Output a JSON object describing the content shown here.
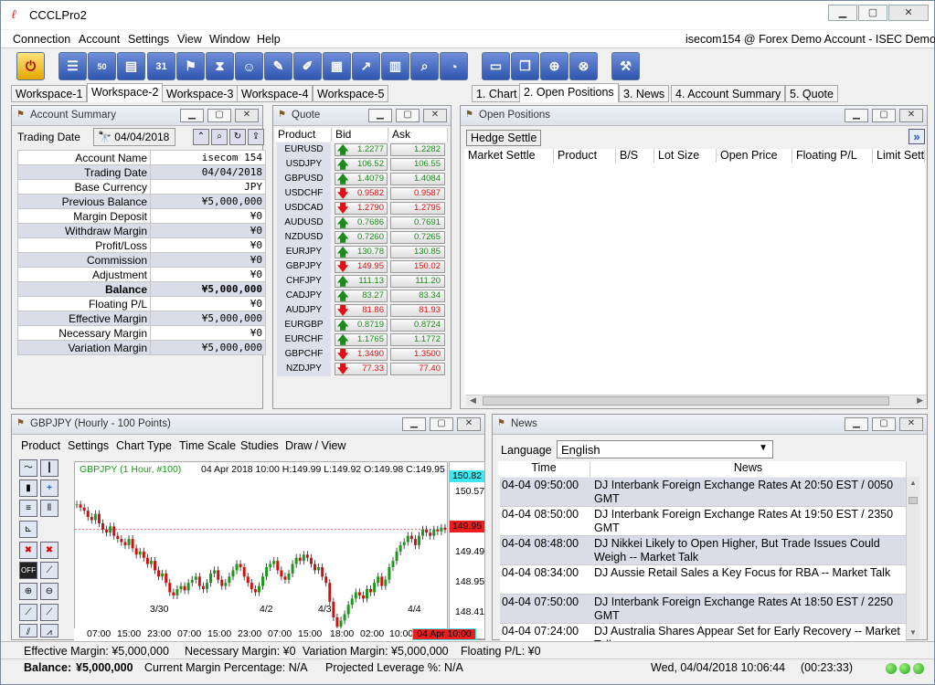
{
  "app": {
    "title": "CCCLPro2"
  },
  "menu": [
    "Connection",
    "Account",
    "Settings",
    "View",
    "Window",
    "Help"
  ],
  "account_label": "isecom154 @ Forex Demo Account - ISEC Demo",
  "workspace_tabs": [
    "Workspace-1",
    "Workspace-2",
    "Workspace-3",
    "Workspace-4",
    "Workspace-5"
  ],
  "view_tabs": [
    "1. Chart",
    "2. Open Positions",
    "3. News",
    "4. Account Summary",
    "5. Quote"
  ],
  "account_summary": {
    "title": "Account Summary",
    "trading_date_label": "Trading Date",
    "trading_date": "04/04/2018",
    "rows": [
      {
        "k": "Account Name",
        "v": "isecom 154"
      },
      {
        "k": "Trading Date",
        "v": "04/04/2018"
      },
      {
        "k": "Base Currency",
        "v": "JPY"
      },
      {
        "k": "Previous Balance",
        "v": "¥5,000,000"
      },
      {
        "k": "Margin Deposit",
        "v": "¥0"
      },
      {
        "k": "Withdraw Margin",
        "v": "¥0"
      },
      {
        "k": "Profit/Loss",
        "v": "¥0"
      },
      {
        "k": "Commission",
        "v": "¥0"
      },
      {
        "k": "Adjustment",
        "v": "¥0"
      },
      {
        "k": "Balance",
        "v": "¥5,000,000"
      },
      {
        "k": "Floating P/L",
        "v": "¥0"
      },
      {
        "k": "Effective Margin",
        "v": "¥5,000,000"
      },
      {
        "k": "Necessary Margin",
        "v": "¥0"
      },
      {
        "k": "Variation Margin",
        "v": "¥5,000,000"
      }
    ]
  },
  "quote": {
    "title": "Quote",
    "headers": [
      "Product",
      "Bid",
      "Ask"
    ],
    "rows": [
      {
        "p": "EURUSD",
        "bid": "1.2277",
        "ask": "1.2282",
        "dir": "up"
      },
      {
        "p": "USDJPY",
        "bid": "106.52",
        "ask": "106.55",
        "dir": "up"
      },
      {
        "p": "GBPUSD",
        "bid": "1.4079",
        "ask": "1.4084",
        "dir": "up"
      },
      {
        "p": "USDCHF",
        "bid": "0.9582",
        "ask": "0.9587",
        "dir": "down"
      },
      {
        "p": "USDCAD",
        "bid": "1.2790",
        "ask": "1.2795",
        "dir": "down"
      },
      {
        "p": "AUDUSD",
        "bid": "0.7686",
        "ask": "0.7691",
        "dir": "up"
      },
      {
        "p": "NZDUSD",
        "bid": "0.7260",
        "ask": "0.7265",
        "dir": "up"
      },
      {
        "p": "EURJPY",
        "bid": "130.78",
        "ask": "130.85",
        "dir": "up"
      },
      {
        "p": "GBPJPY",
        "bid": "149.95",
        "ask": "150.02",
        "dir": "down"
      },
      {
        "p": "CHFJPY",
        "bid": "111.13",
        "ask": "111.20",
        "dir": "up"
      },
      {
        "p": "CADJPY",
        "bid": "83.27",
        "ask": "83.34",
        "dir": "up"
      },
      {
        "p": "AUDJPY",
        "bid": "81.86",
        "ask": "81.93",
        "dir": "down"
      },
      {
        "p": "EURGBP",
        "bid": "0.8719",
        "ask": "0.8724",
        "dir": "up"
      },
      {
        "p": "EURCHF",
        "bid": "1.1765",
        "ask": "1.1772",
        "dir": "up"
      },
      {
        "p": "GBPCHF",
        "bid": "1.3490",
        "ask": "1.3500",
        "dir": "down"
      },
      {
        "p": "NZDJPY",
        "bid": "77.33",
        "ask": "77.40",
        "dir": "down"
      }
    ]
  },
  "open_positions": {
    "title": "Open Positions",
    "hedge_button": "Hedge Settle",
    "columns": [
      "Market Settle",
      "Product",
      "B/S",
      "Lot Size",
      "Open Price",
      "Floating P/L",
      "Limit Settle"
    ]
  },
  "chart": {
    "title": "GBPJPY (Hourly - 100 Points)",
    "menu": [
      "Product",
      "Settings",
      "Chart Type",
      "Time Scale",
      "Studies",
      "Draw / View"
    ],
    "legend": "GBPJPY (1 Hour, #100)",
    "ohlc": "04 Apr 2018 10:00 H:149.99 L:149.92 O:149.98 C:149.95",
    "y_ticks": [
      "150.57",
      "149.49",
      "148.95",
      "148.41"
    ],
    "y_top_tag": "150.82",
    "y_current_tag": "149.95",
    "x_ticks": [
      "07:00",
      "15:00",
      "23:00",
      "07:00",
      "15:00",
      "23:00",
      "07:00",
      "15:00",
      "18:00",
      "02:00",
      "10:00",
      "18:00"
    ],
    "x_current_tag": "04 Apr 10:00",
    "date_labels": [
      "3/30",
      "4/2",
      "4/3",
      "4/4"
    ]
  },
  "chart_data": {
    "type": "candlestick",
    "title": "GBPJPY (1 Hour, #100)",
    "ylim": [
      148.2,
      150.82
    ],
    "close_series": [
      150.35,
      150.3,
      150.25,
      150.15,
      150.1,
      150.2,
      150.05,
      149.95,
      149.9,
      150.0,
      149.85,
      149.8,
      149.75,
      149.7,
      149.8,
      149.65,
      149.55,
      149.6,
      149.5,
      149.4,
      149.45,
      149.3,
      149.2,
      149.25,
      149.1,
      148.95,
      148.9,
      149.0,
      149.05,
      148.98,
      149.1,
      149.15,
      149.2,
      149.05,
      149.0,
      149.1,
      149.25,
      149.3,
      149.15,
      149.05,
      149.1,
      149.2,
      149.3,
      149.4,
      149.35,
      149.2,
      149.1,
      149.0,
      148.95,
      149.05,
      149.2,
      149.35,
      149.4,
      149.45,
      149.3,
      149.2,
      149.15,
      149.25,
      149.4,
      149.5,
      149.45,
      149.55,
      149.5,
      149.4,
      149.3,
      149.35,
      149.2,
      149.1,
      148.8,
      148.55,
      148.4,
      148.5,
      148.6,
      148.75,
      148.85,
      148.95,
      148.9,
      148.85,
      149.0,
      148.95,
      149.1,
      149.2,
      149.05,
      149.15,
      149.35,
      149.45,
      149.6,
      149.7,
      149.75,
      149.85,
      149.8,
      149.7,
      149.85,
      149.95,
      149.9,
      149.85,
      149.95,
      149.92,
      149.98,
      149.95
    ]
  },
  "news": {
    "title": "News",
    "language_label": "Language",
    "language": "English",
    "headers": [
      "Time",
      "News"
    ],
    "rows": [
      {
        "t": "04-04 09:50:00",
        "n": "DJ Interbank Foreign Exchange Rates At 20:50 EST / 0050 GMT"
      },
      {
        "t": "04-04 08:50:00",
        "n": "DJ Interbank Foreign Exchange Rates At 19:50 EST / 2350 GMT"
      },
      {
        "t": "04-04 08:48:00",
        "n": "DJ Nikkei Likely to Open Higher, But Trade Issues Could Weigh -- Market Talk"
      },
      {
        "t": "04-04 08:34:00",
        "n": "DJ Aussie Retail Sales a Key Focus for RBA -- Market Talk"
      },
      {
        "t": "04-04 07:50:00",
        "n": "DJ Interbank Foreign Exchange Rates At 18:50 EST / 2250 GMT"
      },
      {
        "t": "04-04 07:24:00",
        "n": "DJ Australia Shares Appear Set for Early Recovery -- Market Talk"
      }
    ]
  },
  "status": {
    "effective": "Effective Margin: ¥5,000,000",
    "necessary": "Necessary Margin: ¥0",
    "variation": "Variation Margin: ¥5,000,000",
    "floating": "Floating P/L: ¥0",
    "balance_label": "Balance:",
    "balance_value": "¥5,000,000",
    "margin_pct": "Current Margin Percentage: N/A",
    "leverage": "Projected Leverage %: N/A",
    "datetime": "Wed, 04/04/2018 10:06:44",
    "elapsed": "(00:23:33)"
  }
}
